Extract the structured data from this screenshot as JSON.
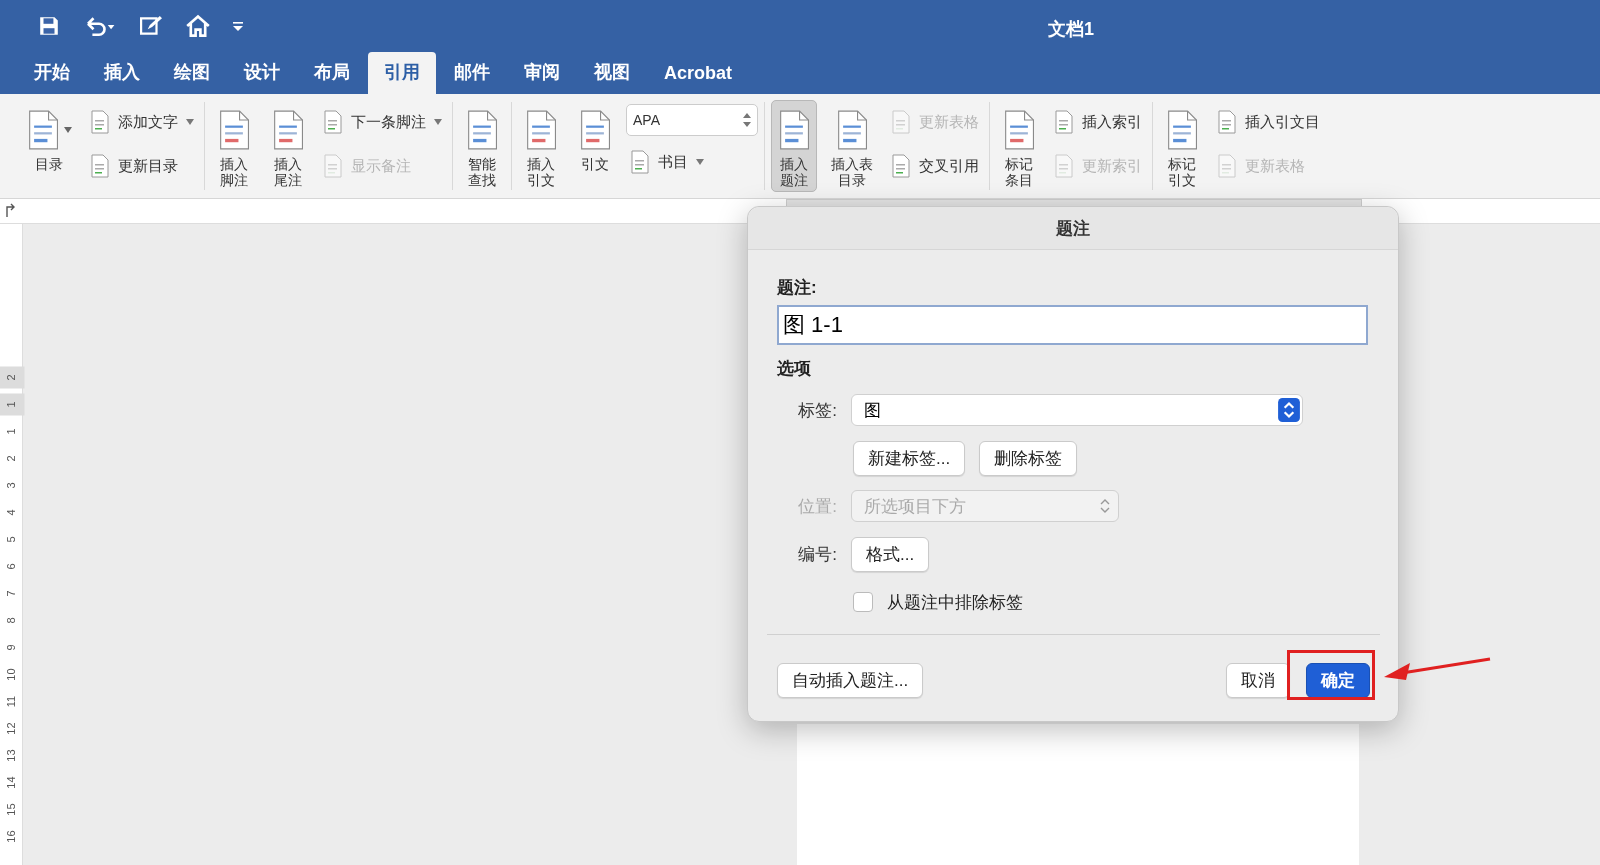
{
  "window": {
    "title": "文档1"
  },
  "tabs": [
    {
      "label": "开始",
      "selected": false
    },
    {
      "label": "插入",
      "selected": false
    },
    {
      "label": "绘图",
      "selected": false
    },
    {
      "label": "设计",
      "selected": false
    },
    {
      "label": "布局",
      "selected": false
    },
    {
      "label": "引用",
      "selected": true
    },
    {
      "label": "邮件",
      "selected": false
    },
    {
      "label": "审阅",
      "selected": false
    },
    {
      "label": "视图",
      "selected": false
    },
    {
      "label": "Acrobat",
      "selected": false
    }
  ],
  "ribbon": {
    "groups": [
      {
        "items": [
          {
            "kind": "large",
            "label": "目录",
            "dropdown": true,
            "selected": false
          },
          {
            "kind": "stack",
            "items": [
              {
                "kind": "small",
                "label": "添加文字",
                "dropdown": true,
                "disabled": false
              },
              {
                "kind": "small",
                "label": "更新目录",
                "dropdown": false,
                "disabled": false
              }
            ]
          }
        ]
      },
      {
        "items": [
          {
            "kind": "large",
            "label": "插入脚注",
            "dropdown": false,
            "selected": false
          },
          {
            "kind": "large",
            "label": "插入尾注",
            "dropdown": false,
            "selected": false
          },
          {
            "kind": "stack",
            "items": [
              {
                "kind": "small",
                "label": "下一条脚注",
                "dropdown": true,
                "disabled": false
              },
              {
                "kind": "small",
                "label": "显示备注",
                "dropdown": false,
                "disabled": true
              }
            ]
          }
        ]
      },
      {
        "items": [
          {
            "kind": "large",
            "label": "智能查找",
            "dropdown": false,
            "selected": false
          }
        ]
      },
      {
        "items": [
          {
            "kind": "large",
            "label": "插入引文",
            "dropdown": false,
            "selected": false
          },
          {
            "kind": "large",
            "label": "引文",
            "dropdown": false,
            "selected": false
          },
          {
            "kind": "stack",
            "items": [
              {
                "kind": "combo",
                "label": "APA"
              },
              {
                "kind": "small",
                "label": "书目",
                "dropdown": true,
                "disabled": false
              }
            ]
          }
        ]
      },
      {
        "items": [
          {
            "kind": "large",
            "label": "插入题注",
            "dropdown": false,
            "selected": true
          },
          {
            "kind": "large",
            "label": "插入表目录",
            "dropdown": false,
            "selected": false
          },
          {
            "kind": "stack",
            "items": [
              {
                "kind": "small",
                "label": "更新表格",
                "dropdown": false,
                "disabled": true
              },
              {
                "kind": "small",
                "label": "交叉引用",
                "dropdown": false,
                "disabled": false
              }
            ]
          }
        ]
      },
      {
        "items": [
          {
            "kind": "large",
            "label": "标记条目",
            "dropdown": false,
            "selected": false
          },
          {
            "kind": "stack",
            "items": [
              {
                "kind": "small",
                "label": "插入索引",
                "dropdown": false,
                "disabled": false
              },
              {
                "kind": "small",
                "label": "更新索引",
                "dropdown": false,
                "disabled": true
              }
            ]
          }
        ]
      },
      {
        "items": [
          {
            "kind": "large",
            "label": "标记引文",
            "dropdown": false,
            "selected": false
          },
          {
            "kind": "stack",
            "items": [
              {
                "kind": "small",
                "label": "插入引文目",
                "dropdown": false,
                "disabled": false
              },
              {
                "kind": "small",
                "label": "更新表格",
                "dropdown": false,
                "disabled": true
              }
            ]
          }
        ]
      }
    ]
  },
  "ruler": {
    "vertical": [
      "2",
      "1",
      "1",
      "2",
      "3",
      "4",
      "5",
      "6",
      "7",
      "8",
      "9",
      "10",
      "11",
      "12",
      "13",
      "14",
      "15",
      "16"
    ]
  },
  "dialog": {
    "title": "题注",
    "caption_label": "题注:",
    "caption_value": "图 1-1",
    "section": "选项",
    "label_label": "标签:",
    "label_value": "图",
    "label_buttons": [
      "新建标签...",
      "删除标签"
    ],
    "position_label": "位置:",
    "position_value": "所选项目下方",
    "position_disabled": true,
    "numbering_label": "编号:",
    "numbering_button": "格式...",
    "exclude_label": {
      "label": "从题注中排除标签",
      "checked": false
    },
    "auto_button": "自动插入题注...",
    "cancel_button": "取消",
    "ok_button": "确定"
  }
}
